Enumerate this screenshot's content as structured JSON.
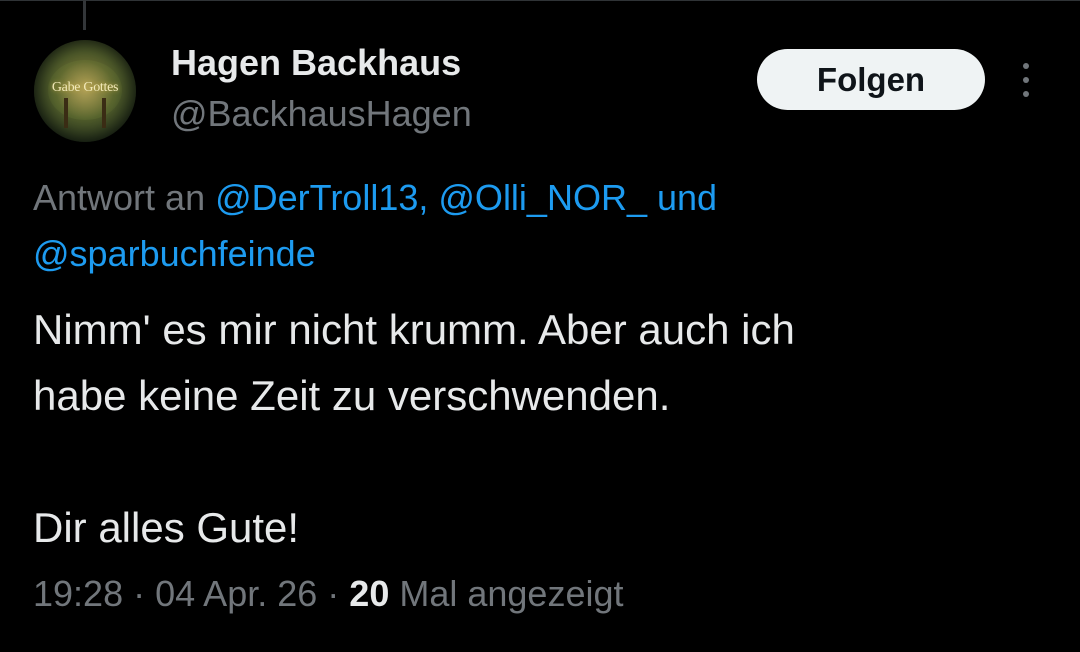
{
  "author": {
    "display_name": "Hagen Backhaus",
    "handle": "@BackhausHagen",
    "avatar_sign_text": "Gabe Gottes"
  },
  "follow_button": {
    "label": "Folgen"
  },
  "more_menu": {
    "icon": "more-vertical-icon"
  },
  "reply_context": {
    "prefix": "Antwort an",
    "mentions": [
      "@DerTroll13,",
      "@Olli_NOR_"
    ],
    "conjunction": "und",
    "last_mention": "@sparbuchfeinde"
  },
  "tweet": {
    "line1": "Nimm' es mir nicht krumm. Aber auch ich",
    "line2": "habe keine Zeit zu verschwenden.",
    "line3": "Dir alles Gute!"
  },
  "meta": {
    "time": "19:28",
    "separator": "·",
    "date": "04 Apr. 26",
    "views_count": "20",
    "views_label": "Mal angezeigt"
  },
  "colors": {
    "background": "#000000",
    "text": "#e7e9ea",
    "secondary": "#71767b",
    "link": "#1d9bf0",
    "button_bg": "#eff3f4"
  }
}
